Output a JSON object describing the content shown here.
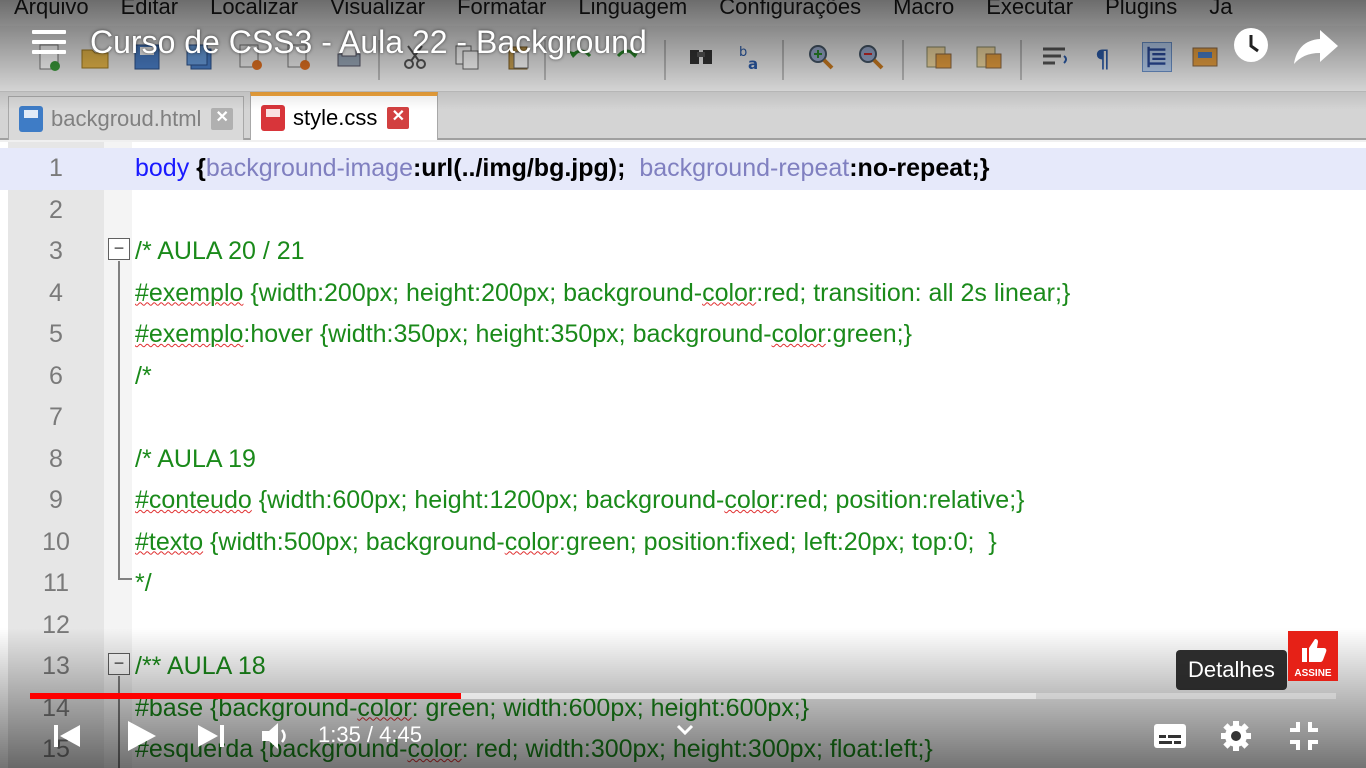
{
  "menubar": {
    "items": [
      "Arquivo",
      "Editar",
      "Localizar",
      "Visualizar",
      "Formatar",
      "Linguagem",
      "Configurações",
      "Macro",
      "Executar",
      "Plugins",
      "Ja"
    ]
  },
  "tabs": [
    {
      "label": "backgroud.html",
      "active": false,
      "icon": "html-file-icon"
    },
    {
      "label": "style.css",
      "active": true,
      "icon": "css-file-icon"
    }
  ],
  "editor": {
    "line_numbers": [
      "1",
      "2",
      "3",
      "4",
      "5",
      "6",
      "7",
      "8",
      "9",
      "10",
      "11",
      "12",
      "13",
      "14",
      "15"
    ],
    "line1": {
      "selector": "body ",
      "open": "{",
      "prop1": "background-image",
      "val1": ":url(../img/bg.jpg);",
      "prop2": "background-repeat",
      "val2": ":no-repeat;}"
    },
    "line3": "/* AULA 20 / 21",
    "line4": {
      "sel": "#exemplo",
      "rest": " {width:200px; height:200px; background-",
      "color": "color",
      "tail": ":red; transition: all 2s linear;}"
    },
    "line5": {
      "sel": "#exemplo",
      "rest": ":hover {width:350px; height:350px; background-",
      "color": "color",
      "tail": ":green;}"
    },
    "line6": "/*",
    "line8": "/* AULA 19",
    "line9": {
      "sel": "#conteudo",
      "rest": " {width:600px; height:1200px; background-",
      "color": "color",
      "tail": ":red; position:relative;}"
    },
    "line10": {
      "sel": "#texto",
      "rest": " {width:500px; background-",
      "color": "color",
      "tail": ":green; position:fixed; left:20px; top:0;  }"
    },
    "line11": "*/",
    "line13": "/** AULA 18",
    "line14": {
      "head": "#base {background-",
      "color": "color",
      "tail": ": green; width:600px; height:600px;}"
    },
    "line15": {
      "head": "#esquerda {background-",
      "color": "color",
      "tail": ": red; width:300px; height:300px; float:left;}"
    }
  },
  "player": {
    "title": "Curso de CSS3 - Aula 22 - Background",
    "time": "1:35 / 4:45",
    "progress_fraction": 0.33,
    "buffer_fraction": 0.77,
    "tooltip": "Detalhes",
    "subscribe_label": "ASSINE",
    "progress_color": "#ff0000"
  }
}
